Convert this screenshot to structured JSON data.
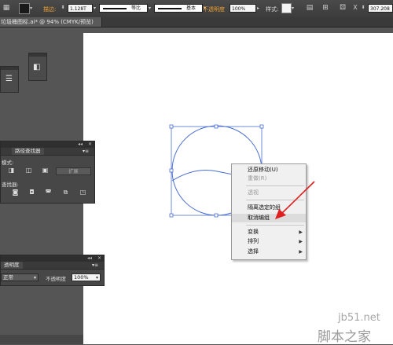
{
  "control_bar": {
    "stroke_label": "描边:",
    "stroke_weight": "1.128T",
    "profile1_label": "等比",
    "profile2_label": "基本",
    "opacity_label": "不透明度",
    "opacity_value": "100%",
    "style_label": "样式:",
    "right_value": "307.208"
  },
  "document_tab": {
    "title": "垃圾桶图标.ai* @ 94% (CMYK/预览)"
  },
  "pathfinder_panel": {
    "tab_inactive": "",
    "tab_active": "路径查找器",
    "shape_modes_label": "模式:",
    "pathfinders_label": "查找器:",
    "expand_label": "扩展"
  },
  "transparency_panel": {
    "tab_label": "透明度",
    "blend_mode": "正常",
    "opacity_label": "不透明度",
    "opacity_value": "100%"
  },
  "context_menu": {
    "items": [
      {
        "label": "还原移动(U)",
        "disabled": false
      },
      {
        "label": "重做(R)",
        "disabled": true
      },
      {
        "label": "透视",
        "disabled": true
      },
      {
        "label": "隔离选定的组",
        "disabled": false
      },
      {
        "label": "取消编组",
        "disabled": false,
        "highlighted": true
      },
      {
        "label": "变换",
        "disabled": false,
        "submenu": true
      },
      {
        "label": "排列",
        "disabled": false,
        "submenu": true
      },
      {
        "label": "选择",
        "disabled": false,
        "submenu": true
      }
    ]
  },
  "watermark": {
    "line1": "jb51.net",
    "line2": "脚本之家"
  },
  "colors": {
    "selection_blue": "#4a6fd0",
    "annotation_red": "#e02020",
    "accent_orange": "#f0a030"
  }
}
